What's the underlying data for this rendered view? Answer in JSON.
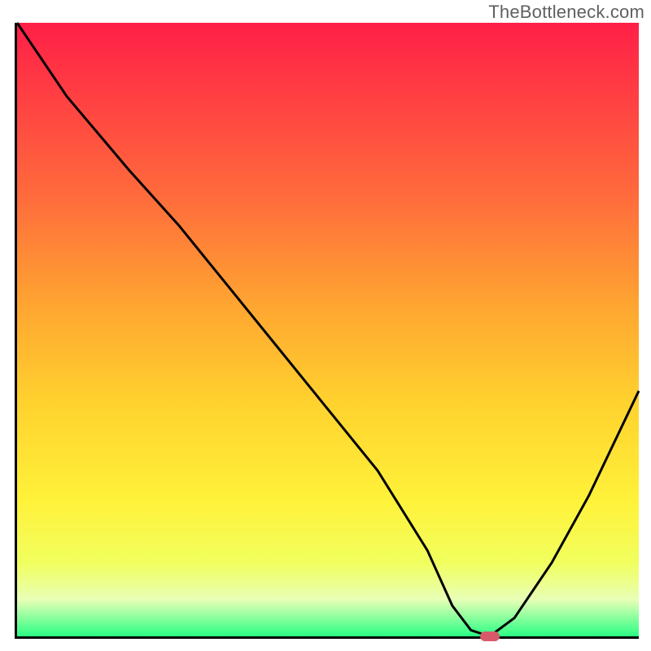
{
  "watermark": "TheBottleneck.com",
  "colors": {
    "red": "#ff1f47",
    "orange1": "#ff6a3c",
    "orange2": "#ffa531",
    "yellow1": "#ffd22e",
    "yellow2": "#fff23a",
    "yellowgreen": "#f1ff5e",
    "palegreen": "#e8ffb6",
    "green": "#2aff84",
    "marker": "#d85a6a",
    "axis": "#000000"
  },
  "gradient_stops": [
    {
      "offset": 0.0,
      "color": "red"
    },
    {
      "offset": 0.28,
      "color": "orange1"
    },
    {
      "offset": 0.46,
      "color": "orange2"
    },
    {
      "offset": 0.62,
      "color": "yellow1"
    },
    {
      "offset": 0.78,
      "color": "yellow2"
    },
    {
      "offset": 0.88,
      "color": "yellowgreen"
    },
    {
      "offset": 0.94,
      "color": "palegreen"
    },
    {
      "offset": 1.0,
      "color": "green"
    }
  ],
  "chart_data": {
    "type": "line",
    "title": "",
    "xlabel": "",
    "ylabel": "",
    "xlim": [
      0,
      100
    ],
    "ylim": [
      0,
      100
    ],
    "series": [
      {
        "name": "bottleneck-curve",
        "x": [
          0,
          8,
          18,
          26,
          34,
          42,
          50,
          58,
          66,
          70,
          73,
          76,
          80,
          86,
          92,
          100
        ],
        "y": [
          100,
          88,
          76,
          67,
          57,
          47,
          37,
          27,
          14,
          5,
          1,
          0,
          3,
          12,
          23,
          40
        ]
      }
    ],
    "annotations": [
      {
        "name": "optimal-marker",
        "x": 76,
        "y": 0
      }
    ]
  }
}
